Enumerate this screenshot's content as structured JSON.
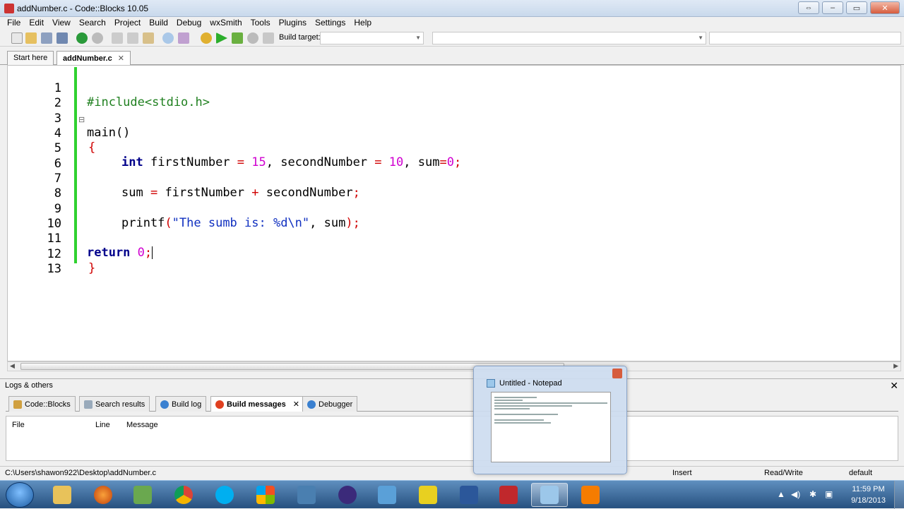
{
  "window": {
    "title": "addNumber.c - Code::Blocks 10.05"
  },
  "menu": [
    "File",
    "Edit",
    "View",
    "Search",
    "Project",
    "Build",
    "Debug",
    "wxSmith",
    "Tools",
    "Plugins",
    "Settings",
    "Help"
  ],
  "toolbar": {
    "build_target_label": "Build target:"
  },
  "tabs": [
    {
      "label": "Start here"
    },
    {
      "label": "addNumber.c",
      "active": true
    }
  ],
  "code": {
    "line_numbers": [
      "1",
      "2",
      "3",
      "4",
      "5",
      "6",
      "7",
      "8",
      "9",
      "10",
      "11",
      "12",
      "13"
    ],
    "l1": "#include<stdio.h>",
    "l3": "main()",
    "l4": "{",
    "l5": {
      "kw": "int",
      "a": " firstNumber ",
      "eq1": "=",
      "n1": " 15",
      "b": ", secondNumber ",
      "eq2": "=",
      "n2": " 10",
      "c": ", sum",
      "eq3": "=",
      "n3": "0",
      "d": ";"
    },
    "l7": {
      "a": "sum ",
      "eq": "=",
      "b": " firstNumber ",
      "plus": "+",
      "c": " secondNumber",
      "semi": ";"
    },
    "l9": {
      "a": "printf",
      "p1": "(",
      "s": "\"The sumb is: %d\\n\"",
      "b": ", sum",
      "p2": ")",
      "semi": ";"
    },
    "l11": {
      "kw": "return",
      "n": " 0",
      "semi": ";"
    },
    "l12": "}"
  },
  "logs": {
    "caption": "Logs & others",
    "tabs": [
      "Code::Blocks",
      "Search results",
      "Build log",
      "Build messages",
      "Debugger"
    ],
    "columns": [
      "File",
      "Line",
      "Message"
    ]
  },
  "status": {
    "path": "C:\\Users\\shawon922\\Desktop\\addNumber.c",
    "mode": "Insert",
    "access": "Read/Write",
    "profile": "default"
  },
  "preview": {
    "title": "Untitled - Notepad"
  },
  "taskbar": {
    "time": "11:59 PM",
    "date": "9/18/2013"
  },
  "colors": {
    "gutter_change": "#2fd12f",
    "keyword": "#00008b",
    "number": "#d000d0",
    "string": "#1030c0",
    "operator": "#d00000",
    "preprocessor": "#208020"
  }
}
